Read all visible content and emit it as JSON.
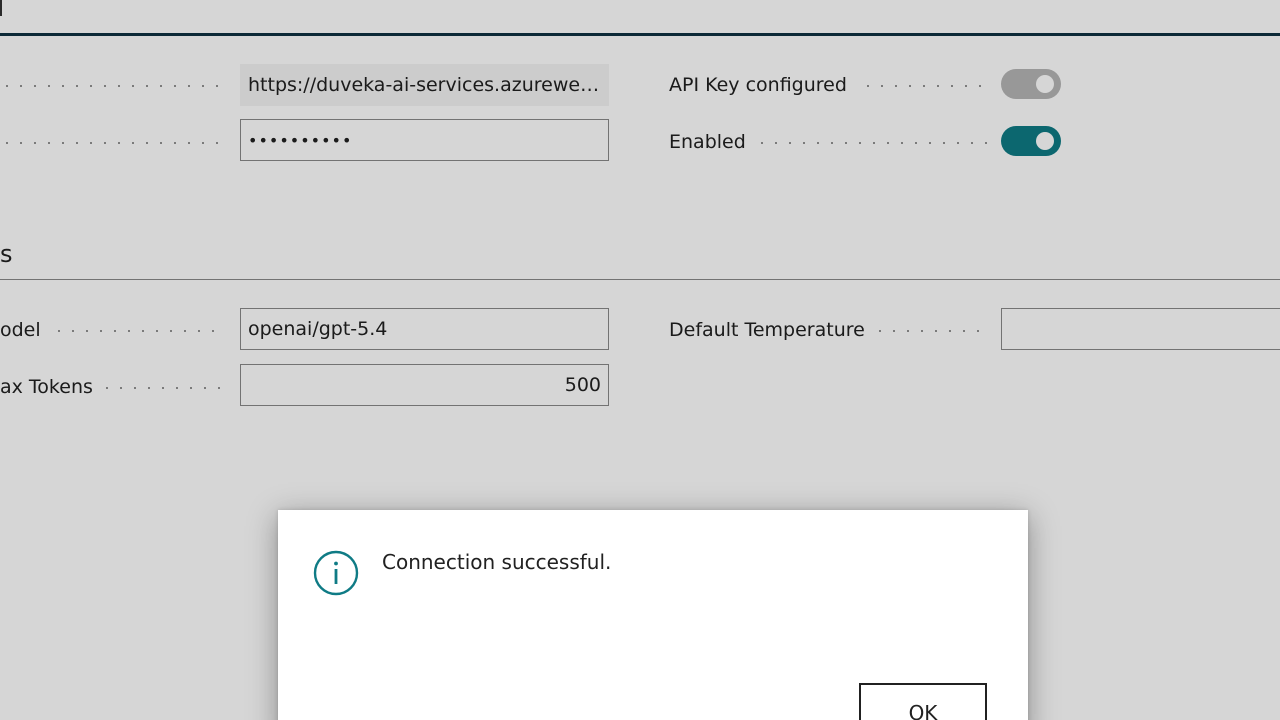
{
  "general": {
    "endpoint_value": "https://duveka-ai-services.azureweb...",
    "api_key_value": "••••••••••",
    "api_key_configured_label": "API Key configured",
    "enabled_label": "Enabled"
  },
  "settings_section": {
    "title": "s",
    "model_label": "odel",
    "model_value": "openai/gpt-5.4",
    "max_tokens_label": "ax Tokens",
    "max_tokens_value": "500",
    "default_temperature_label": "Default Temperature",
    "default_temperature_value": ""
  },
  "dialog": {
    "message": "Connection successful.",
    "ok_label": "OK",
    "icon": "info-icon"
  },
  "colors": {
    "accent": "#0f7b85",
    "text": "#212121"
  }
}
